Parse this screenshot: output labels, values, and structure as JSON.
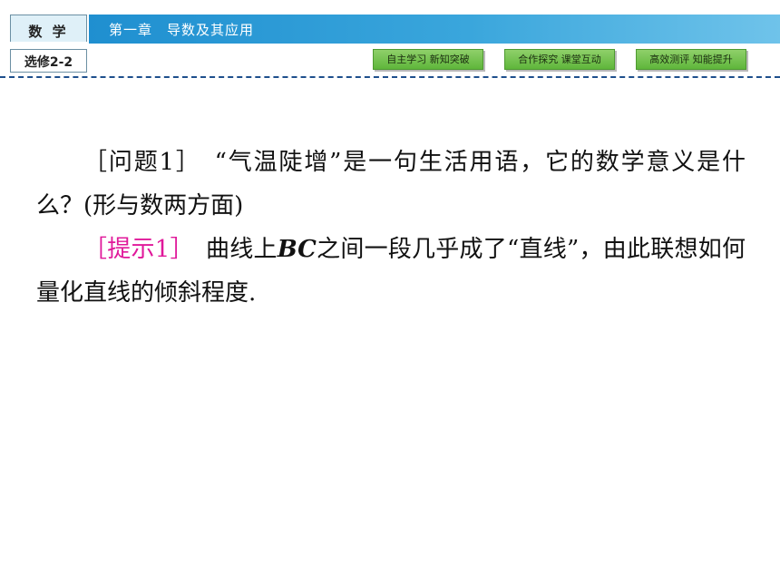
{
  "header": {
    "subject": "数 学",
    "edition": "选修2-2",
    "chapter": "第一章　导数及其应用",
    "nav": [
      {
        "label": "自主学习 新知突破"
      },
      {
        "label": "合作探究 课堂互动"
      },
      {
        "label": "高效测评 知能提升"
      }
    ]
  },
  "content": {
    "question": {
      "label": "［问题1］",
      "text": "“气温陡增”是一句生活用语，它的数学意义是什么？(形与数两方面)"
    },
    "hint": {
      "label": "［提示1］",
      "text_before": "曲线上",
      "text_italic": "BC",
      "text_after": "之间一段几乎成了“直线”，由此联想如何量化直线的倾斜程度."
    },
    "colors": {
      "hint_label": "#e0189a",
      "header_gradient_start": "#1f8fd0",
      "nav_button": "#5fb63b",
      "dashed_line": "#1e4f8c"
    }
  }
}
